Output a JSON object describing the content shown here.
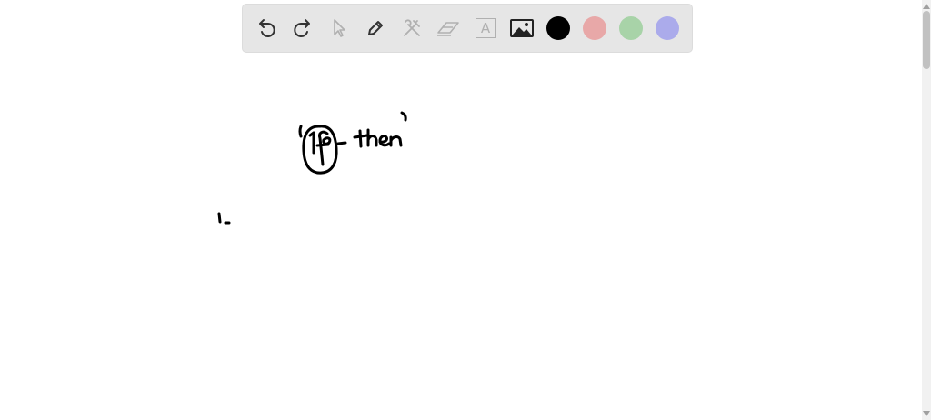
{
  "toolbar": {
    "tools": [
      {
        "name": "undo-icon",
        "enabled": true
      },
      {
        "name": "redo-icon",
        "enabled": true
      },
      {
        "name": "select-pointer-icon",
        "enabled": false
      },
      {
        "name": "pen-icon",
        "enabled": true
      },
      {
        "name": "tools-icon",
        "enabled": false
      },
      {
        "name": "eraser-icon",
        "enabled": false
      },
      {
        "name": "text-box-icon",
        "enabled": false
      },
      {
        "name": "image-icon",
        "enabled": true
      }
    ],
    "text_tool_glyph": "A",
    "colors": [
      {
        "name": "black",
        "hex": "#000000"
      },
      {
        "name": "red",
        "hex": "#e8a8a8"
      },
      {
        "name": "green",
        "hex": "#a8d3a8"
      },
      {
        "name": "blue",
        "hex": "#ababeb"
      }
    ]
  },
  "canvas": {
    "ink_color": "#000000"
  }
}
